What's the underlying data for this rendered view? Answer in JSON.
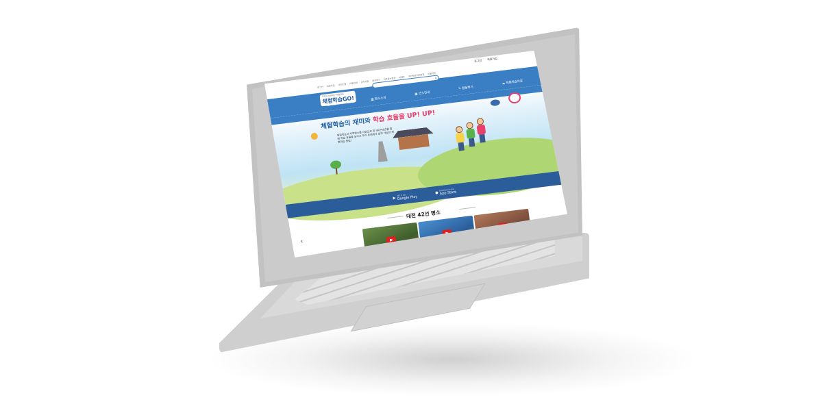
{
  "utility_links": [
    "로그인",
    "회원가입",
    "사이트맵",
    "이용안내",
    "공지사항",
    "문의하기",
    "자주묻는질문",
    "이벤트",
    "개인정보처리방침",
    "이용약관"
  ],
  "login_links": [
    "로그인",
    "회원가입"
  ],
  "logo": {
    "tagline": "지역과 함께하는 체험학습",
    "name": "체험학습GO!"
  },
  "search": {
    "placeholder": ""
  },
  "menu": [
    {
      "label": "대전소개",
      "icon": "info-icon"
    },
    {
      "label": "명소소개",
      "icon": "building-icon"
    },
    {
      "label": "코스안내",
      "icon": "map-icon"
    },
    {
      "label": "활동하기",
      "icon": "edit-icon"
    },
    {
      "label": "체험학습자료",
      "icon": "cloud-icon"
    }
  ],
  "hero": {
    "title_plain": "체험학습의 재미와 ",
    "title_highlight": "학습 효율을 UP! UP!",
    "subtitle": "체험학습과 지역명소를 대상으로 한 VR콘텐츠를 통해 학습 효율을 높이고 우리 동네에서 쉽게 가능한 체험학습 방법!"
  },
  "app_stores": [
    {
      "small": "GET IT ON",
      "label": "Google Play"
    },
    {
      "small": "Download on the",
      "label": "App Store"
    }
  ],
  "section": {
    "title": "대전 42선 명소"
  },
  "colors": {
    "primary": "#3a7fc4",
    "dark_blue": "#2a5d99",
    "accent": "#e8416b"
  }
}
